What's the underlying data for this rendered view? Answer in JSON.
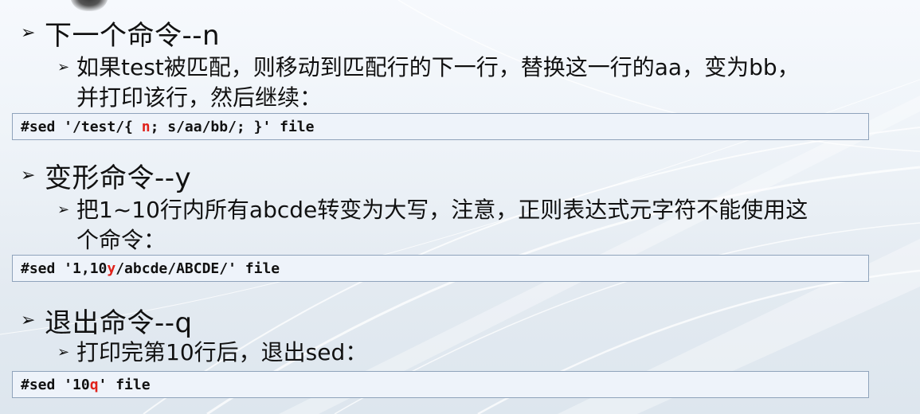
{
  "sections": [
    {
      "heading": "下一个命令--n",
      "desc_line1": "如果test被匹配，则移动到匹配行的下一行，替换这一行的aa，变为bb，",
      "desc_line2": "并打印该行，然后继续：",
      "code_before": "#sed '/test/{ ",
      "code_highlight": "n",
      "code_after": "; s/aa/bb/; }' file"
    },
    {
      "heading": "变形命令--y",
      "desc_line1": "把1~10行内所有abcde转变为大写，注意，正则表达式元字符不能使用这",
      "desc_line2": "个命令：",
      "code_before": "#sed '1,10",
      "code_highlight": "y",
      "code_after": "/abcde/ABCDE/' file"
    },
    {
      "heading": "退出命令--q",
      "desc_line1": "打印完第10行后，退出sed：",
      "code_before": "#sed '10",
      "code_highlight": "q",
      "code_after": "' file"
    }
  ],
  "icons": {
    "bullet": "arrow-bullet-icon"
  },
  "colors": {
    "code_highlight": "#e0211a",
    "code_border": "#8fa3bb"
  }
}
